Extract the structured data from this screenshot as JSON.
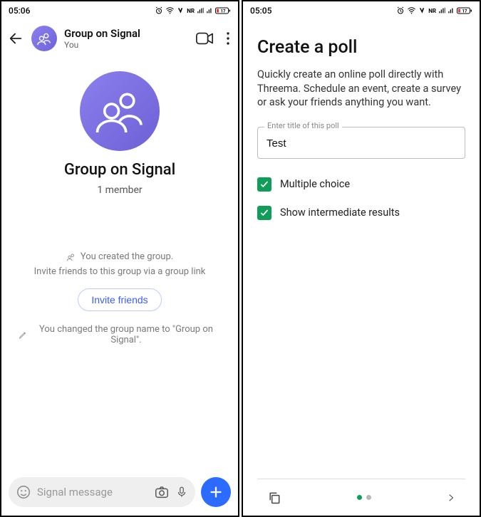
{
  "left": {
    "status_time": "05:06",
    "header": {
      "title": "Group on Signal",
      "subtitle": "You"
    },
    "group": {
      "name": "Group on Signal",
      "members": "1 member"
    },
    "system": {
      "created": "You created the group.",
      "invite_line": "Invite friends to this group via a group link",
      "invite_button": "Invite friends",
      "renamed": "You changed the group name to \"Group on Signal\"."
    },
    "compose": {
      "placeholder": "Signal message"
    }
  },
  "right": {
    "status_time": "05:05",
    "title": "Create a poll",
    "description": "Quickly create an online poll directly with Threema. Schedule an event, create a survey or ask your friends anything you want.",
    "field": {
      "label": "Enter title of this poll",
      "value": "Test"
    },
    "checks": {
      "multiple": "Multiple choice",
      "intermediate": "Show intermediate results"
    }
  }
}
